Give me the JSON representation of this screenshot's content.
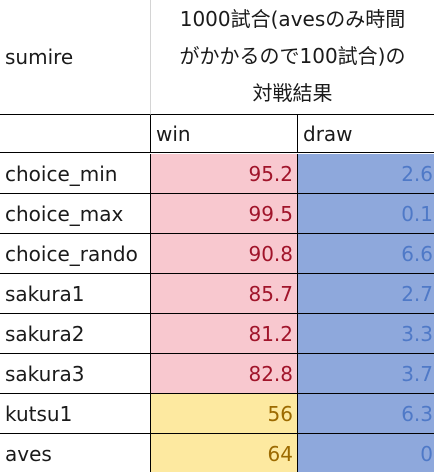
{
  "header": {
    "label": "sumire",
    "title_line1": "1000試合(avesのみ時間",
    "title_line2": "がかかるので100試合)の",
    "title_line3": "対戦結果"
  },
  "columns": {
    "win": "win",
    "draw": "draw"
  },
  "rows": [
    {
      "name": "choice_min",
      "win": "95.2",
      "draw": "2.6",
      "win_color": "pink"
    },
    {
      "name": "choice_max",
      "win": "99.5",
      "draw": "0.1",
      "win_color": "pink"
    },
    {
      "name": "choice_rando",
      "win": "90.8",
      "draw": "6.6",
      "win_color": "pink"
    },
    {
      "name": "sakura1",
      "win": "85.7",
      "draw": "2.7",
      "win_color": "pink"
    },
    {
      "name": "sakura2",
      "win": "81.2",
      "draw": "3.3",
      "win_color": "pink"
    },
    {
      "name": "sakura3",
      "win": "82.8",
      "draw": "3.7",
      "win_color": "pink"
    },
    {
      "name": "kutsu1",
      "win": "56",
      "draw": "6.3",
      "win_color": "yellow"
    },
    {
      "name": "aves",
      "win": "64",
      "draw": "0",
      "win_color": "yellow"
    }
  ],
  "colors": {
    "pink_fill": "#f8c8cf",
    "pink_text": "#a0142a",
    "yellow_fill": "#fde9a0",
    "yellow_text": "#9c6a00",
    "blue_fill": "#8ea8dc",
    "blue_text": "#4f79c7"
  }
}
